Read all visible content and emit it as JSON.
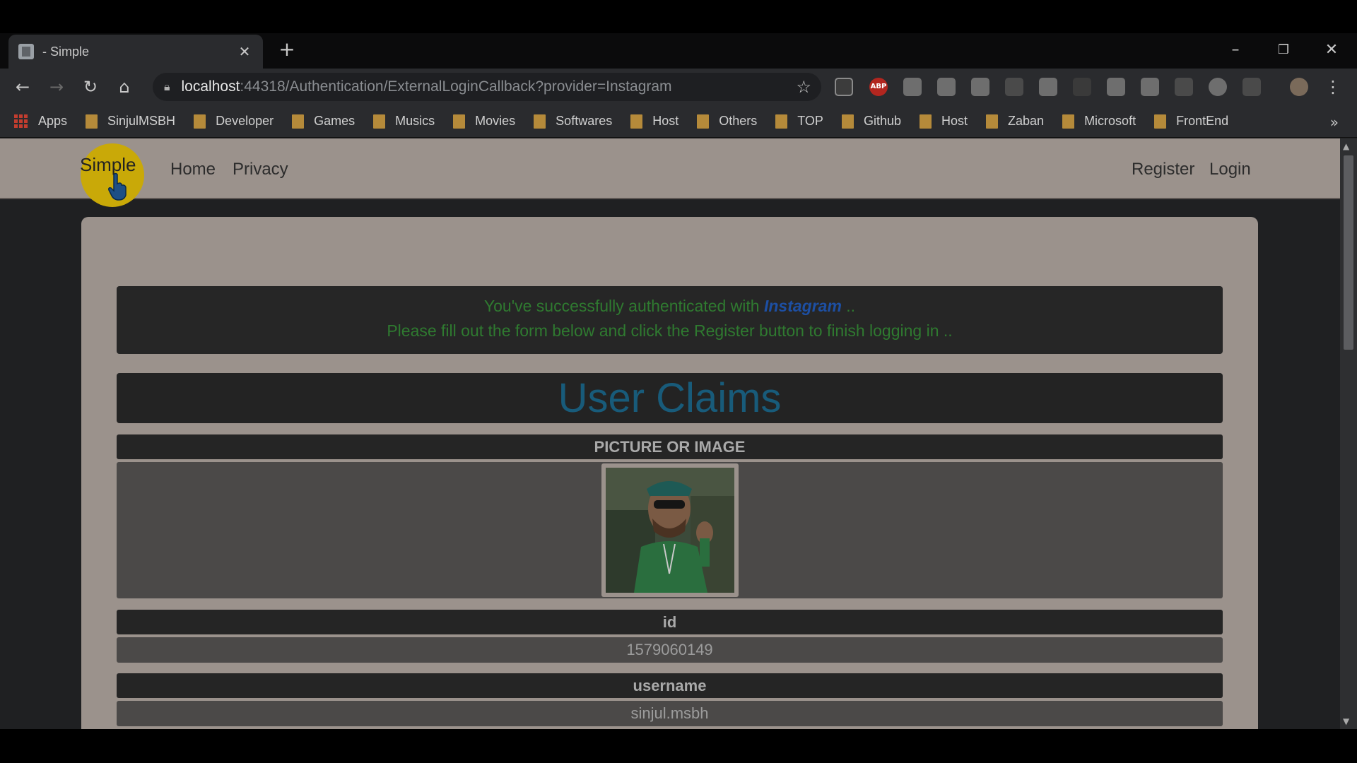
{
  "browser": {
    "tab_title": "- Simple",
    "url_host": "localhost",
    "url_path": ":44318/Authentication/ExternalLoginCallback?provider=Instagram",
    "extensions": [
      "ABP"
    ]
  },
  "bookmarks": [
    "Apps",
    "SinjulMSBH",
    "Developer",
    "Games",
    "Musics",
    "Movies",
    "Softwares",
    "Host",
    "Others",
    "TOP",
    "Github",
    "Host",
    "Zaban",
    "Microsoft",
    "FrontEnd"
  ],
  "site": {
    "brand": "Simple",
    "nav_left": [
      "Home",
      "Privacy"
    ],
    "nav_right": [
      "Register",
      "Login"
    ]
  },
  "alert": {
    "line1_prefix": "You've successfully authenticated with ",
    "provider": "Instagram",
    "line1_suffix": " ..",
    "line2": "Please fill out the form below and click the Register button to finish logging in .."
  },
  "claims": {
    "title": "User Claims",
    "picture_header": "PICTURE OR IMAGE",
    "fields": [
      {
        "name": "id",
        "value": "1579060149"
      },
      {
        "name": "username",
        "value": "sinjul.msbh"
      }
    ]
  }
}
